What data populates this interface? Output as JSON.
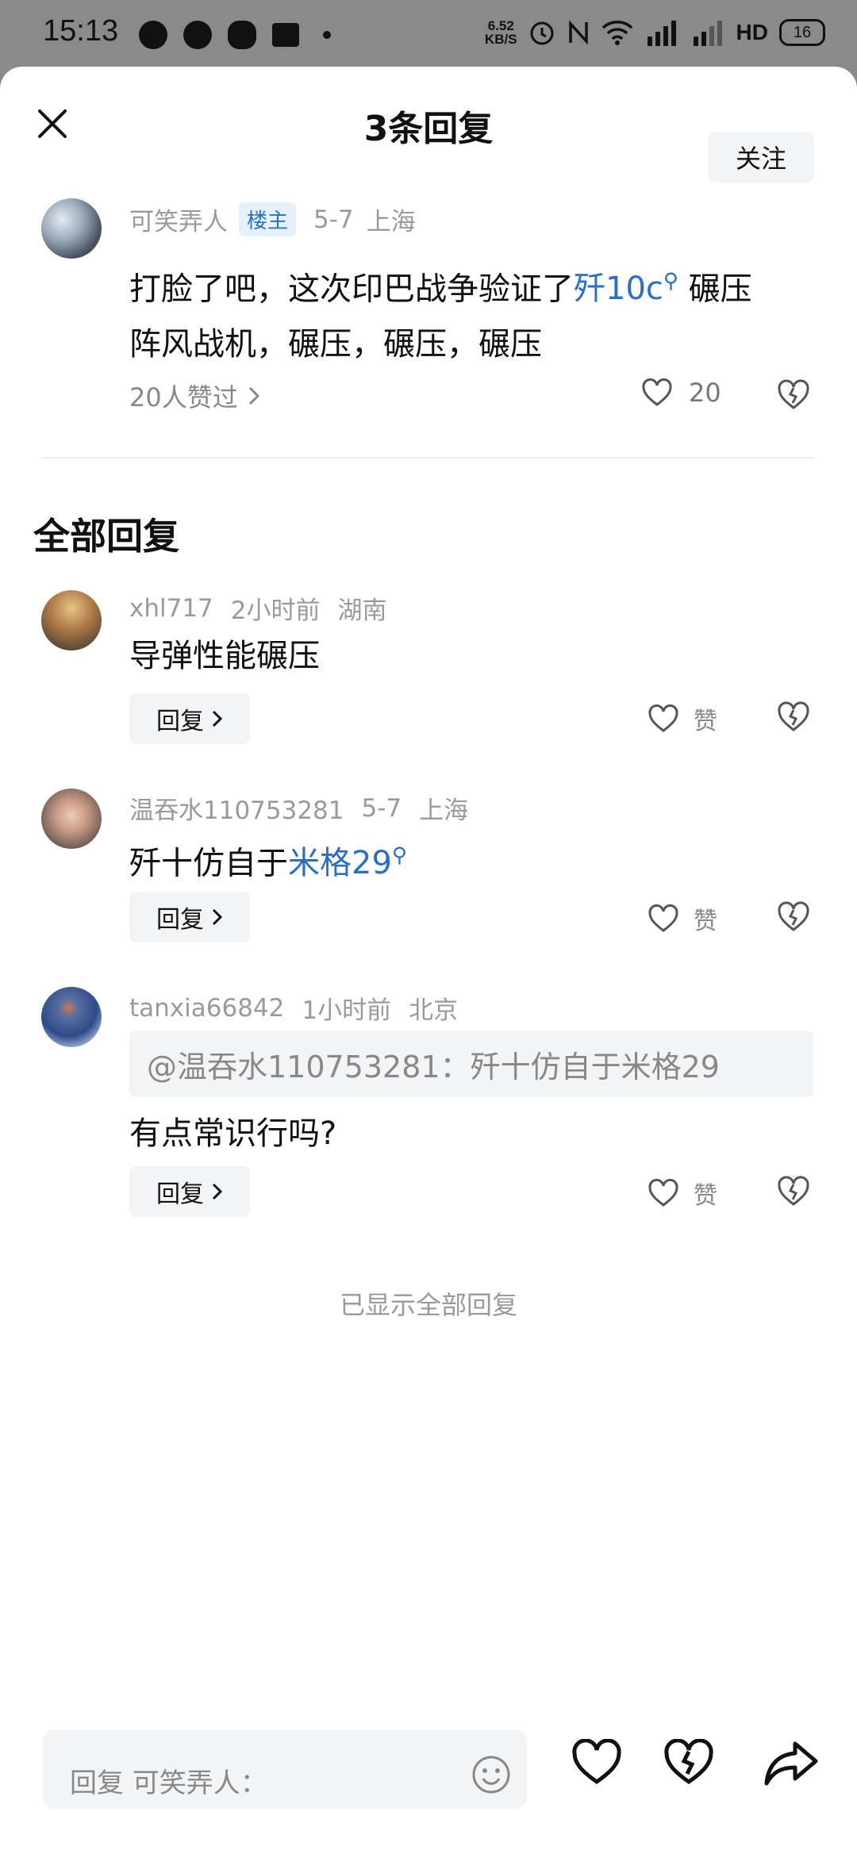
{
  "status_bar": {
    "time": "15:13",
    "net_speed_value": "6.52",
    "net_speed_unit": "KB/S",
    "hd_label": "HD",
    "battery": "16"
  },
  "header": {
    "title": "3条回复"
  },
  "main_comment": {
    "username": "可笑弄人",
    "badge": "楼主",
    "date": "5-7",
    "location": "上海",
    "follow_label": "关注",
    "text_part1": "打脸了吧，这次印巴战争验证了",
    "link_text": "歼10c",
    "text_part2": " 碾压",
    "text_line2": "阵风战机，碾压，碾压，碾压",
    "likers_text": "20人赞过",
    "like_count": "20"
  },
  "section_title": "全部回复",
  "replies": [
    {
      "username": "xhl717",
      "time": "2小时前",
      "location": "湖南",
      "text": "导弹性能碾压",
      "reply_label": "回复",
      "like_label": "赞"
    },
    {
      "username": "温吞水110753281",
      "time": "5-7",
      "location": "上海",
      "text_part1": "歼十仿自于",
      "link_text": "米格29",
      "reply_label": "回复",
      "like_label": "赞"
    },
    {
      "username": "tanxia66842",
      "time": "1小时前",
      "location": "北京",
      "quote": "@温吞水110753281：歼十仿自于米格29",
      "text": "有点常识行吗?",
      "reply_label": "回复",
      "like_label": "赞"
    }
  ],
  "end_note": "已显示全部回复",
  "bottom_bar": {
    "input_placeholder": "回复 可笑弄人："
  }
}
